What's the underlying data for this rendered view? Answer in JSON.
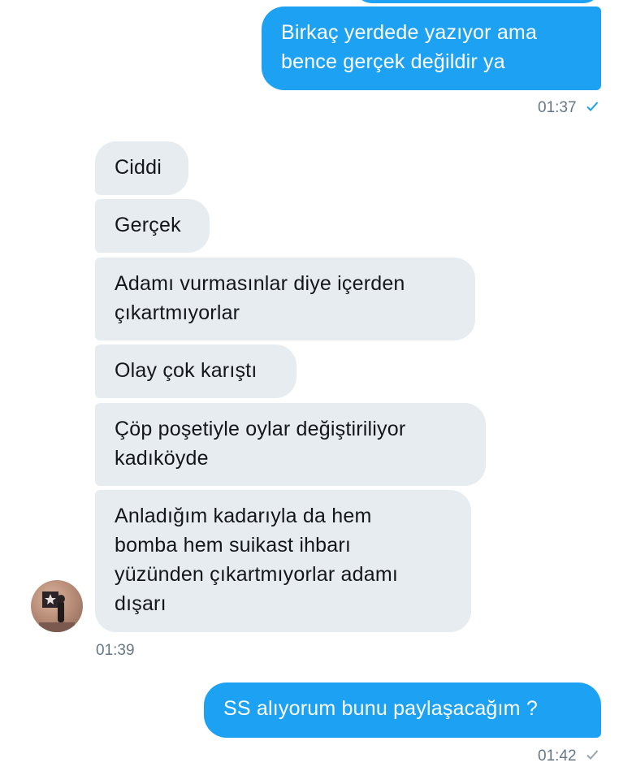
{
  "messages_top": {
    "msg1": {
      "line1": "Birkaç yerdede yazıyor ama",
      "line2": "bence gerçek değildir ya",
      "time": "01:37"
    }
  },
  "incoming": {
    "m1": "Ciddi",
    "m2": "Gerçek",
    "m3": {
      "line1": "Adamı vurmasınlar diye içerden",
      "line2": "çıkartmıyorlar"
    },
    "m4": "Olay çok karıştı",
    "m5": {
      "line1": "Çöp poşetiyle oylar değiştiriliyor",
      "line2": "kadıköyde"
    },
    "m6": {
      "line1": "Anladığım kadarıyla da hem",
      "line2": "bomba hem suikast ihbarı",
      "line3": "yüzünden çıkartmıyorlar adamı",
      "line4": "dışarı"
    },
    "time": "01:39"
  },
  "outgoing_bottom": {
    "text": "SS alıyorum bunu paylaşacağım ?",
    "time": "01:42"
  },
  "colors": {
    "outgoing_bubble": "#1da1f2",
    "incoming_bubble": "#e6ecf0",
    "read_check": "#1da1f2",
    "sent_check": "#9aa5ad",
    "timestamp": "#657786"
  },
  "icons": {
    "read_receipt": "check-icon",
    "sent_receipt": "check-icon",
    "avatar": "avatar-photo"
  }
}
